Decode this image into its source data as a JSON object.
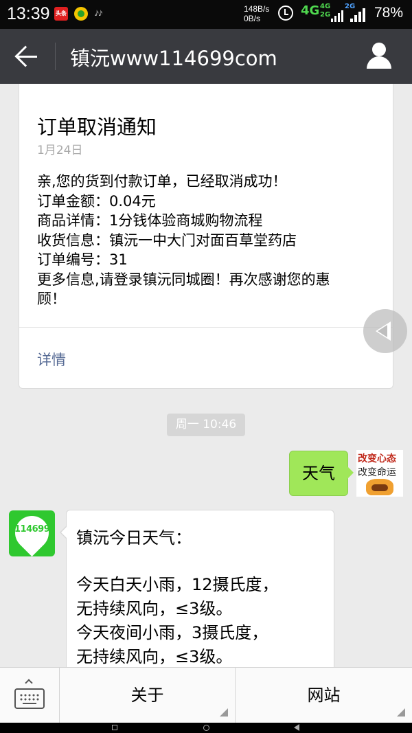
{
  "status_bar": {
    "time": "13:39",
    "app_badge_1": "头条",
    "net_speed_up": "148B/s",
    "net_speed_down": "0B/s",
    "network_type": "4G",
    "sim2_types": [
      "4G",
      "2G"
    ],
    "sim3_type": "2G",
    "battery": "78%"
  },
  "title_bar": {
    "title": "镇沅www114699com"
  },
  "notice_card": {
    "title": "订单取消通知",
    "date": "1月24日",
    "lines": [
      "亲,您的货到付款订单，已经取消成功！",
      "订单金额：0.04元",
      "商品详情：1分钱体验商城购物流程",
      "收货信息：镇沅一中大门对面百草堂药店",
      "订单编号：31",
      "更多信息,请登录镇沅同城圈！再次感谢您的惠",
      "顾！"
    ],
    "link": "详情"
  },
  "chat": {
    "timestamp": "周一 10:46",
    "outgoing_message": "天气",
    "my_avatar": {
      "line1": "改变心态",
      "line2": "改变命运"
    },
    "bot_avatar_text": "114699",
    "incoming_lines": [
      "镇沅今日天气：",
      "",
      "今天白天小雨，12摄氏度，",
      "无持续风向，≤3级。",
      "今天夜间小雨，3摄氏度，",
      "无持续风向，≤3级。"
    ]
  },
  "bottom_menu": {
    "items": [
      "关于",
      "网站"
    ]
  },
  "colors": {
    "title_bar": "#393a3f",
    "bubble_out": "#a0e759",
    "link": "#576b95",
    "bot_avatar": "#2fc82f"
  }
}
